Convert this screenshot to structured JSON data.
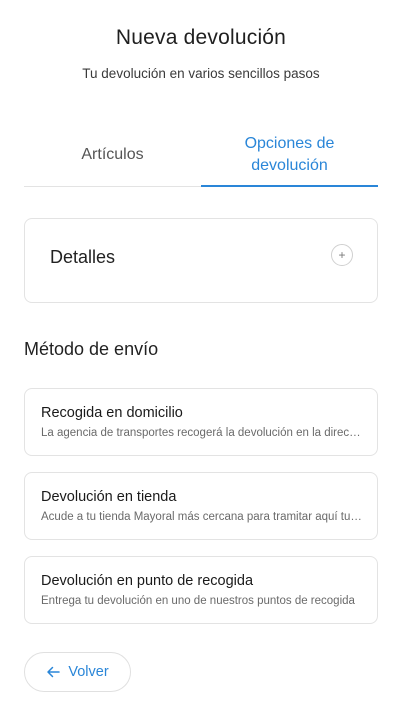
{
  "header": {
    "title": "Nueva devolución",
    "subtitle": "Tu devolución en varios sencillos pasos"
  },
  "tabs": [
    {
      "label": "Artículos",
      "active": false
    },
    {
      "label": "Opciones de devolución",
      "active": true
    }
  ],
  "details": {
    "label": "Detalles",
    "icon": "plus-icon",
    "icon_glyph": "+"
  },
  "shipping": {
    "title": "Método de envío",
    "options": [
      {
        "title": "Recogida en domicilio",
        "description": "La agencia de transportes recogerá la devolución en la dirección que indiques"
      },
      {
        "title": "Devolución en tienda",
        "description": "Acude a tu tienda Mayoral más cercana para tramitar aquí tu devolución"
      },
      {
        "title": "Devolución en punto de recogida",
        "description": "Entrega tu devolución en uno de nuestros puntos de recogida"
      }
    ]
  },
  "back_button": {
    "label": "Volver",
    "icon": "arrow-left-icon"
  },
  "colors": {
    "accent": "#2a86d8",
    "border": "#e3e3e3"
  }
}
